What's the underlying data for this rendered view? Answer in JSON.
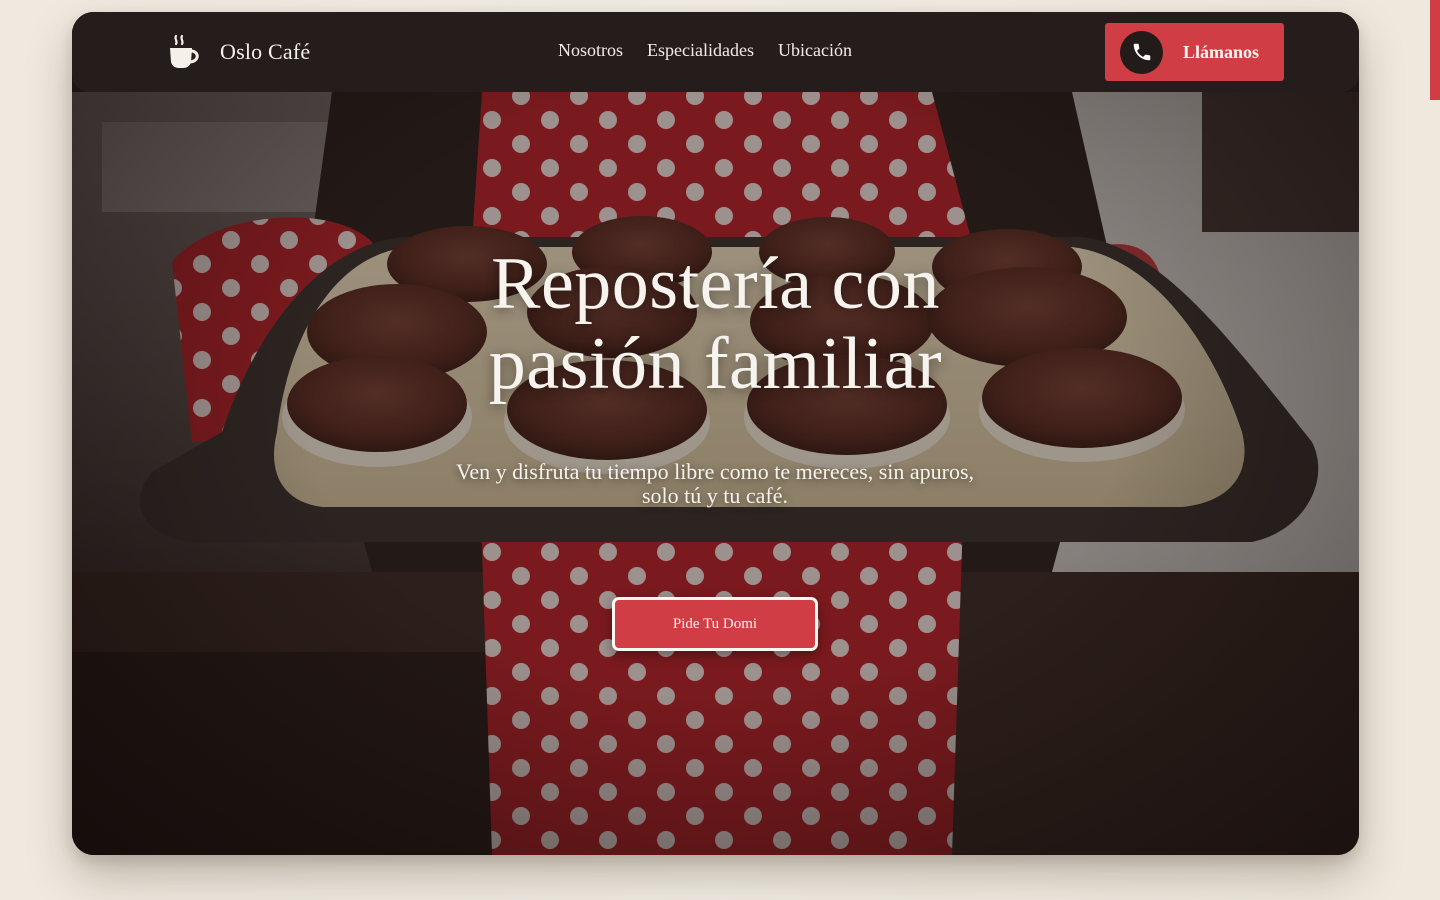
{
  "brand": {
    "name": "Oslo Café",
    "logo_icon": "coffee-cup-icon"
  },
  "nav": {
    "items": [
      {
        "label": "Nosotros"
      },
      {
        "label": "Especialidades"
      },
      {
        "label": "Ubicación"
      }
    ]
  },
  "call_button": {
    "label": "Llámanos",
    "icon": "phone-icon"
  },
  "hero": {
    "headline_line1": "Repostería con",
    "headline_line2": "pasión familiar",
    "subtitle": "Ven y disfruta tu tiempo libre como te mereces, sin apuros, solo tú y tu café.",
    "cta_label": "Pide Tu Domi",
    "image": "baker-holding-muffin-tray"
  },
  "colors": {
    "accent": "#d13d44",
    "header_bg": "#251c1c",
    "page_bg": "#f0ebe2",
    "text_light": "#f7f3ee"
  }
}
